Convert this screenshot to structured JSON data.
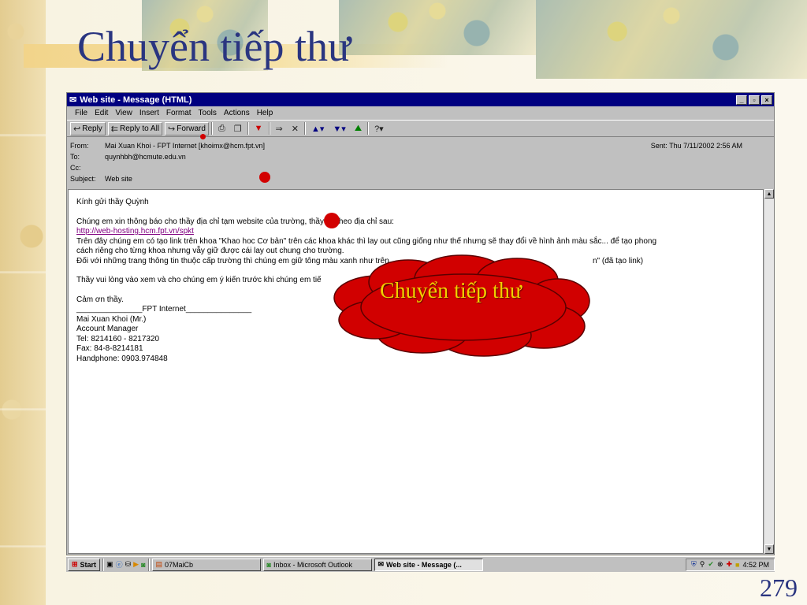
{
  "slide": {
    "title": "Chuyển tiếp thư",
    "page_number": "279",
    "callout": "Chuyển tiếp thư"
  },
  "window": {
    "title": "Web site - Message (HTML)",
    "controls": [
      "_",
      "▫",
      "×"
    ],
    "menu": [
      "File",
      "Edit",
      "View",
      "Insert",
      "Format",
      "Tools",
      "Actions",
      "Help"
    ],
    "toolbar": {
      "reply": "Reply",
      "reply_all": "Reply to All",
      "forward": "Forward"
    }
  },
  "message": {
    "from_label": "From:",
    "from": "Mai Xuan Khoi - FPT Internet [khoimx@hcm.fpt.vn]",
    "sent_label": "Sent:",
    "sent": "Thu 7/11/2002 2:56 AM",
    "to_label": "To:",
    "to": "quynhbh@hcmute.edu.vn",
    "cc_label": "Cc:",
    "cc": "",
    "subject_label": "Subject:",
    "subject": "Web site",
    "body": {
      "greeting": "Kính gửi thầy Quỳnh",
      "line1": "Chúng em xin thông báo cho thầy địa chỉ tạm website của trường, thầy vô theo địa chỉ sau:",
      "link": "http://web-hosting.hcm.fpt.vn/spkt",
      "line2": "Trên đây chúng em có tạo link trên khoa \"Khao hoc Cơ bản\" trên các khoa khác thì lay out cũng giống như thế nhưng sẽ thay đổi về hình ảnh màu sắc... để tạo phong",
      "line3": "cách riêng cho từng khoa nhưng vẫy giữ được cái lay out chung cho trường.",
      "line4": "Đối với những trang thông tin thuộc cấp trường thì chúng em giữ tông màu xanh như trên",
      "line4_tail": "n\" (đã tạo link)",
      "line5": "Thầy vui lòng vào xem và cho chúng em ý kiến trước khi chúng em tiế",
      "thanks": "Cảm ơn thầy.",
      "sig1": "_______________FPT Internet_______________",
      "sig2": "Mai Xuan Khoi (Mr.)",
      "sig3": "Account Manager",
      "sig4": "Tel: 8214160 - 8217320",
      "sig5": "Fax: 84-8-8214181",
      "sig6": "Handphone: 0903.974848"
    }
  },
  "taskbar": {
    "start": "Start",
    "tasks": [
      "07MaiCb",
      "Inbox - Microsoft Outlook",
      "Web site - Message (..."
    ],
    "clock": "4:52 PM"
  }
}
